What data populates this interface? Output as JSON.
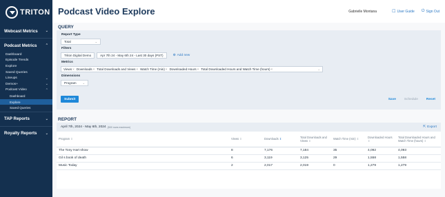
{
  "sidebar": {
    "logo": "TRITON",
    "groups": [
      {
        "label": "Webcast Metrics",
        "chevron": "v"
      },
      {
        "label": "Podcast Metrics",
        "chevron": "^"
      }
    ],
    "podcast_items": [
      "Dashboard",
      "Episode Trends",
      "Explore",
      "Saved Queries"
    ],
    "lineups": "Lineups",
    "demos": "Demos+",
    "podcast_video": "Podcast Video",
    "video_items": [
      "Dashboard",
      "Explore",
      "Saved Queries"
    ],
    "tap_reports": "TAP Reports",
    "royalty_reports": "Royalty Reports"
  },
  "header": {
    "title": "Podcast Video Explore",
    "user": "Gabrielle Montana",
    "user_guide": "User Guide",
    "sign_out": "Sign Out"
  },
  "query": {
    "section_title": "QUERY",
    "report_type_label": "Report Type",
    "report_type_value": "Total",
    "filters_label": "Filters",
    "filter_chip_1": "Triton Digital Demo",
    "filter_chip_2": "Apr 7th 24 - May 6th 24 - Last 30 days (PST)",
    "add_new": "Add new",
    "metrics_label": "Metrics",
    "metrics": [
      "Views",
      "Downloads",
      "Total Downloads and Views",
      "Watch Time (min)",
      "Downloaded Hours",
      "Total Downloaded Hours and Watch Time (hours)"
    ],
    "dimensions_label": "Dimensions",
    "dimension_value": "Program",
    "submit": "Submit",
    "save": "Save",
    "schedule": "Schedule",
    "reset": "Reset"
  },
  "report": {
    "section_title": "REPORT",
    "date_range": "April 7th, 2024 - May 6th, 2024",
    "date_note": "(500 rows maximum)",
    "export": "Export",
    "columns": [
      "Program",
      "Views",
      "Downloads",
      "Total Downloads and Views",
      "Watch Time (min)",
      "Downloaded Hours",
      "Total Downloaded Hours and Watch Time (hours)"
    ],
    "rows": [
      [
        "The Tony Hart show",
        "8",
        "7,176",
        "7,184",
        "35",
        "4,092",
        "4,093"
      ],
      [
        "Gil s book of death",
        "6",
        "3,119",
        "3,125",
        "29",
        "1,558",
        "1,558"
      ],
      [
        "Music Today",
        "2",
        "2,017",
        "2,019",
        "0",
        "1,279",
        "1,279"
      ]
    ]
  },
  "colors": {
    "sidebar": "#14304f",
    "accent": "#1e88d9",
    "active": "#1f5f9c"
  }
}
